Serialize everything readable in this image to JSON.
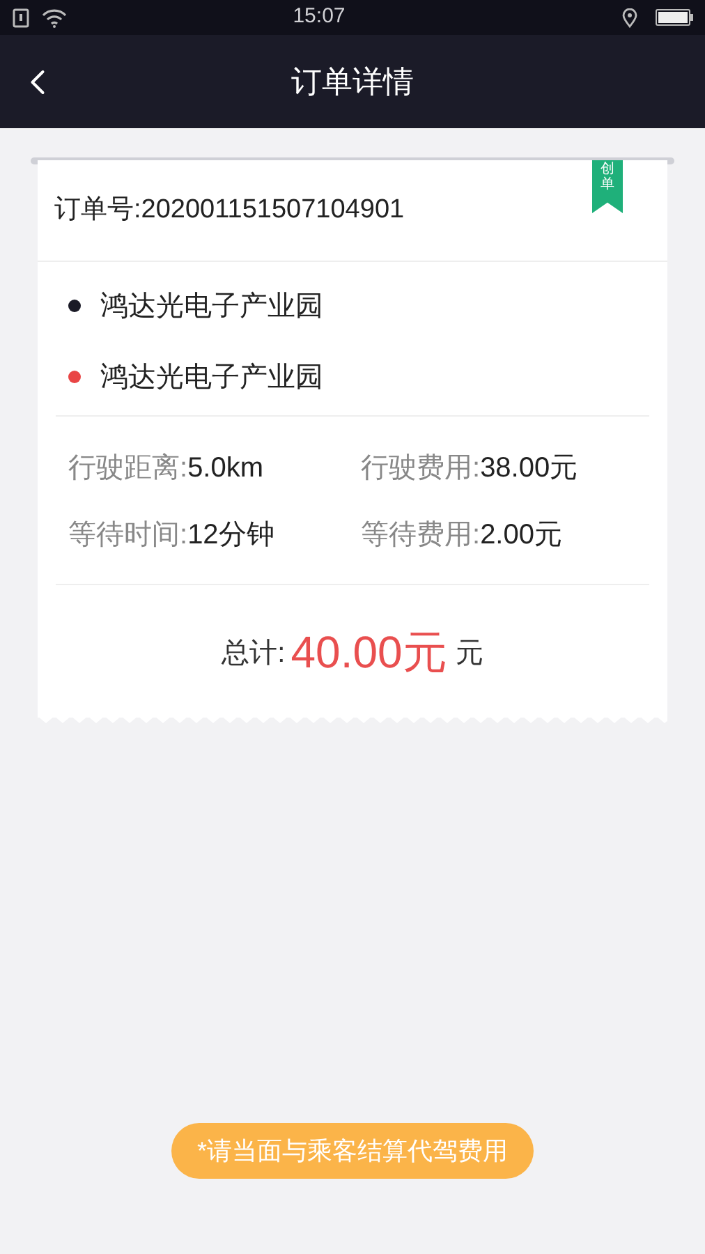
{
  "status_bar": {
    "time": "15:07"
  },
  "nav": {
    "title": "订单详情"
  },
  "order": {
    "number": "订单号:202001151507104901",
    "badge": "创单"
  },
  "addresses": [
    {
      "text": "鸿达光电子产业园",
      "color": "#1a1a26"
    },
    {
      "text": "鸿达光电子产业园",
      "color": "#e94545"
    }
  ],
  "stats": [
    {
      "label": "行驶距离:",
      "value": "5.0km"
    },
    {
      "label": "行驶费用:",
      "value": "38.00元"
    },
    {
      "label": "等待时间:",
      "value": "12分钟"
    },
    {
      "label": "等待费用:",
      "value": "2.00元"
    }
  ],
  "total": {
    "label": "总计:",
    "amount": "40.00元",
    "unit": "元"
  },
  "notice": "*请当面与乘客结算代驾费用"
}
